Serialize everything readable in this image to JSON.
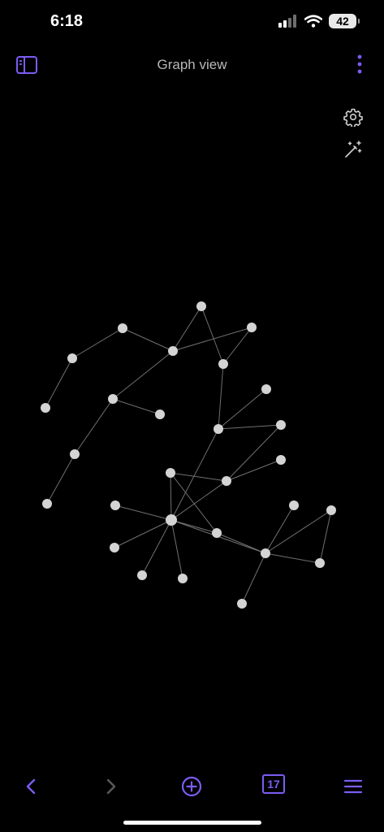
{
  "status": {
    "time": "6:18",
    "battery": "42",
    "icons": [
      "cellular-signal-icon",
      "wifi-icon",
      "battery-icon"
    ]
  },
  "header": {
    "title": "Graph view",
    "left_icon": "sidebar-toggle-icon",
    "right_icon": "more-vertical-icon"
  },
  "graph_controls": {
    "icons": [
      "gear-icon",
      "magic-wand-icon"
    ]
  },
  "graph": {
    "node_color": "#d4d4d4",
    "edge_color": "#707070",
    "node_count": 30,
    "edge_count": 36
  },
  "toolbar": {
    "back_icon": "chevron-left-icon",
    "forward_icon": "chevron-right-icon",
    "new_note_icon": "plus-circle-icon",
    "calendar_day": "17",
    "menu_icon": "hamburger-menu-icon",
    "accent": "#7c5cf5",
    "disabled": "#5a5a5a"
  }
}
